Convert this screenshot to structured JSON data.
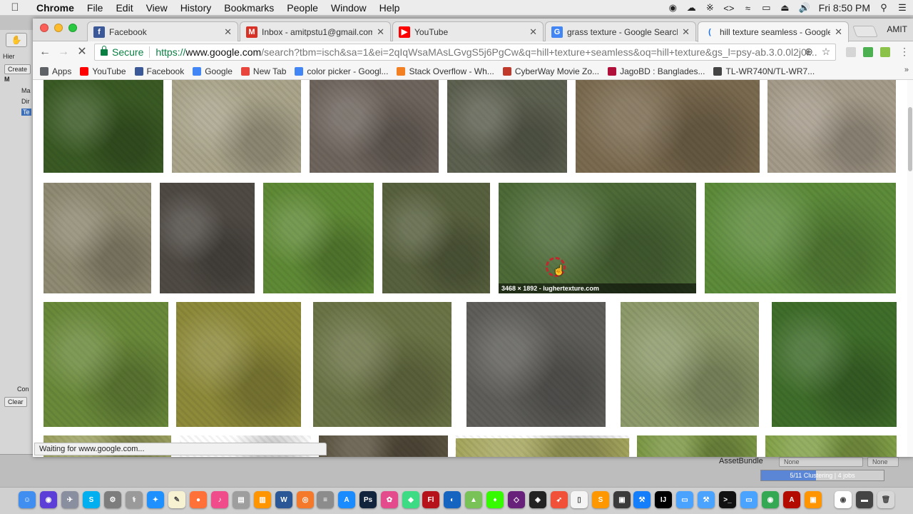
{
  "menubar": {
    "app": "Chrome",
    "items": [
      "File",
      "Edit",
      "View",
      "History",
      "Bookmarks",
      "People",
      "Window",
      "Help"
    ],
    "clock": "Fri 8:50 PM"
  },
  "unity": {
    "labels": [
      "Hier",
      "Create",
      "M",
      "Ma",
      "Dir",
      "Te"
    ],
    "console_label": "Con",
    "clear_label": "Clear",
    "asset_bundle_label": "AssetBundle",
    "asset_bundle_value": "None",
    "asset_bundle_variant": "None",
    "progress_text": "5/11 Clustering | 4 jobs",
    "progress_fraction": 0.45
  },
  "chrome": {
    "profile_name": "AMIT",
    "tabs": [
      {
        "title": "Facebook",
        "icon": "facebook-icon",
        "color": "#3b5998",
        "glyph": "f"
      },
      {
        "title": "Inbox - amitpstu1@gmail.com",
        "icon": "gmail-icon",
        "color": "#d93025",
        "glyph": "M"
      },
      {
        "title": "YouTube",
        "icon": "youtube-icon",
        "color": "#ff0000",
        "glyph": "▶"
      },
      {
        "title": "grass texture - Google Search",
        "icon": "google-icon",
        "color": "#4285f4",
        "glyph": "G"
      },
      {
        "title": "hill texture seamless - Google",
        "icon": "loading-icon",
        "color": "#1a73e8",
        "glyph": "("
      }
    ],
    "address": {
      "secure_label": "Secure",
      "scheme": "https://",
      "host": "www.google.com",
      "path": "/search?tbm=isch&sa=1&ei=2qIqWsaMAsLGvgS5j6PgCw&q=hill+texture+seamless&oq=hill+texture&gs_l=psy-ab.3.0.0l2j0i..."
    },
    "bookmarks": [
      {
        "label": "Apps",
        "icon": "apps-grid-icon",
        "color": "#5f6368"
      },
      {
        "label": "YouTube",
        "icon": "youtube-icon",
        "color": "#ff0000"
      },
      {
        "label": "Facebook",
        "icon": "facebook-icon",
        "color": "#3b5998"
      },
      {
        "label": "Google",
        "icon": "google-icon",
        "color": "#4285f4"
      },
      {
        "label": "New Tab",
        "icon": "new-tab-icon",
        "color": "#e8453c"
      },
      {
        "label": "color picker - Googl...",
        "icon": "google-icon",
        "color": "#4285f4"
      },
      {
        "label": "Stack Overflow - Wh...",
        "icon": "stackoverflow-icon",
        "color": "#f48024"
      },
      {
        "label": "CyberWay Movie Zo...",
        "icon": "cyberway-icon",
        "color": "#c0392b"
      },
      {
        "label": "JagoBD : Banglades...",
        "icon": "jagobd-icon",
        "color": "#b0103a"
      },
      {
        "label": "TL-WR740N/TL-WR7...",
        "icon": "tplink-icon",
        "color": "#444444"
      }
    ],
    "hover_caption": "3468 × 1892 - lughertexture.com",
    "status": "Waiting for www.google.com..."
  },
  "images": [
    {
      "color": "#3a5a24"
    },
    {
      "color": "#a9a48a"
    },
    {
      "color": "#6e655d"
    },
    {
      "color": "#5d6150"
    },
    {
      "color": "#7a6a4f"
    },
    {
      "color": "#a59b8a"
    },
    {
      "color": "#8f8a72"
    },
    {
      "color": "#4f4a44"
    },
    {
      "color": "#5f8a35"
    },
    {
      "color": "#58613f"
    },
    {
      "color": "#4d6a37"
    },
    {
      "color": "#5c8b3a"
    },
    {
      "color": "#6a8a3a"
    },
    {
      "color": "#8d8a3a"
    },
    {
      "color": "#6b7446"
    },
    {
      "color": "#5f5e5a"
    },
    {
      "color": "#8d9a6a"
    },
    {
      "color": "#3f6d2a"
    },
    {
      "color": "#9ba060"
    },
    {
      "color": "#ffffff"
    },
    {
      "color": "#5b5341"
    },
    {
      "color": "#ffffff"
    },
    {
      "color": "#a6a75e"
    },
    {
      "color": "#7c9845"
    },
    {
      "color": "#83a248"
    }
  ]
}
